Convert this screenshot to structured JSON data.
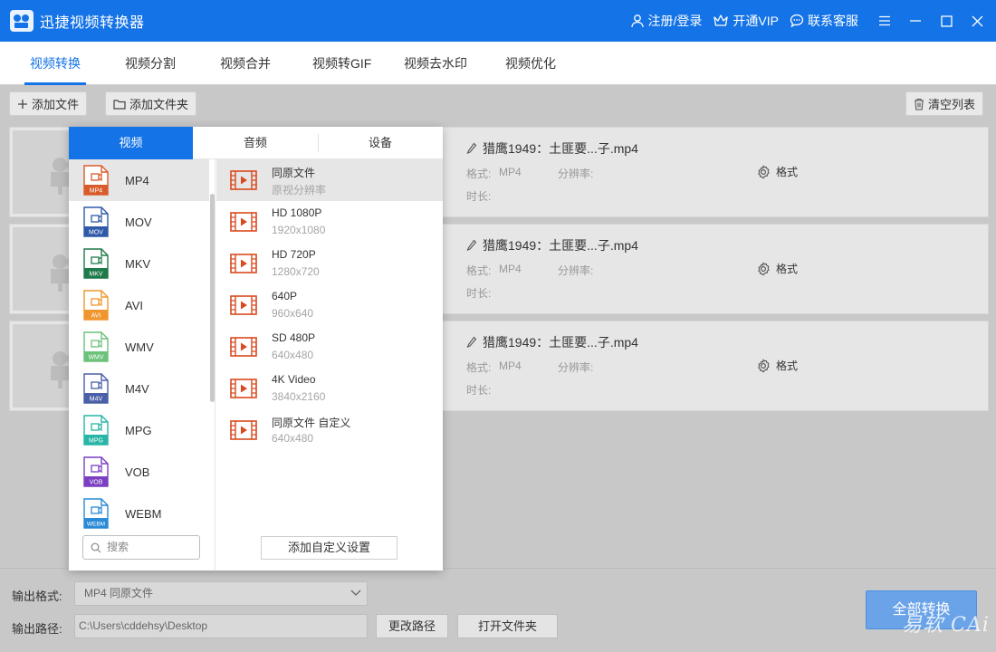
{
  "window": {
    "title": "迅捷视频转换器"
  },
  "titlebar": {
    "login": "注册/登录",
    "vip": "开通VIP",
    "service": "联系客服"
  },
  "nav": {
    "tabs": [
      "视频转换",
      "视频分割",
      "视频合并",
      "视频转GIF",
      "视频去水印",
      "视频优化"
    ]
  },
  "toolbar": {
    "add_file": "添加文件",
    "add_folder": "添加文件夹",
    "clear_list": "清空列表"
  },
  "files": [
    {
      "name": "猎鹰1949：土匪要...子.mp4",
      "format_label": "格式:",
      "format": "MP4",
      "resolution_label": "分辨率:",
      "resolution": "",
      "duration_label": "时长:",
      "duration": "",
      "settings": "格式"
    },
    {
      "name": "猎鹰1949：土匪要...子.mp4",
      "format_label": "格式:",
      "format": "MP4",
      "resolution_label": "分辨率:",
      "resolution": "",
      "duration_label": "时长:",
      "duration": "",
      "settings": "格式"
    },
    {
      "name": "猎鹰1949：土匪要...子.mp4",
      "format_label": "格式:",
      "format": "MP4",
      "resolution_label": "分辨率:",
      "resolution": "",
      "duration_label": "时长:",
      "duration": "",
      "settings": "格式"
    }
  ],
  "popup": {
    "tabs": [
      "视频",
      "音频",
      "设备"
    ],
    "formats": [
      {
        "label": "MP4",
        "color": "#d95b2b"
      },
      {
        "label": "MOV",
        "color": "#2f5aa8"
      },
      {
        "label": "MKV",
        "color": "#1f7a4a"
      },
      {
        "label": "AVI",
        "color": "#f0962e"
      },
      {
        "label": "WMV",
        "color": "#6cc27a"
      },
      {
        "label": "M4V",
        "color": "#4a5fa8"
      },
      {
        "label": "MPG",
        "color": "#27b5a5"
      },
      {
        "label": "VOB",
        "color": "#7a3fc2"
      },
      {
        "label": "WEBM",
        "color": "#2a8ad6"
      }
    ],
    "presets": [
      {
        "name": "同原文件",
        "res": "原视分辨率"
      },
      {
        "name": "HD 1080P",
        "res": "1920x1080"
      },
      {
        "name": "HD 720P",
        "res": "1280x720"
      },
      {
        "name": "640P",
        "res": "960x640"
      },
      {
        "name": "SD 480P",
        "res": "640x480"
      },
      {
        "name": "4K Video",
        "res": "3840x2160"
      },
      {
        "name": "同原文件 自定义",
        "res": "640x480"
      }
    ],
    "search_placeholder": "搜索",
    "add_custom": "添加自定义设置"
  },
  "bottom": {
    "format_label": "输出格式:",
    "format_value": "MP4  同原文件",
    "path_label": "输出路径:",
    "path_value": "C:\\Users\\cddehsy\\Desktop",
    "change_path": "更改路径",
    "open_folder": "打开文件夹",
    "convert_all": "全部转换",
    "watermark": "易软 CAi"
  },
  "colors": {
    "accent": "#1473e6",
    "preset_icon": "#d94a1e"
  }
}
